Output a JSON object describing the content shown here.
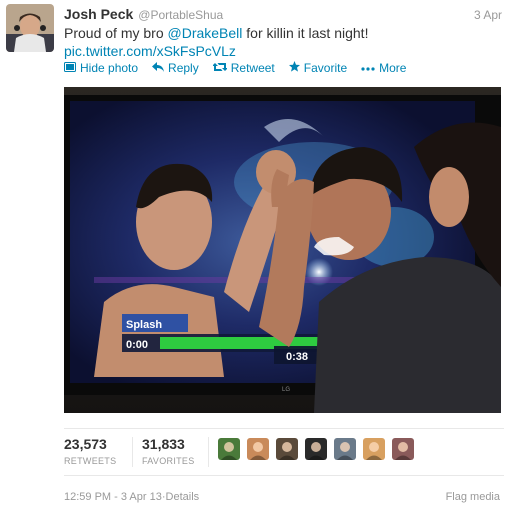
{
  "tweet": {
    "fullname": "Josh Peck",
    "username": "@PortableShua",
    "date": "3 Apr",
    "text_before": "Proud of my bro ",
    "mention": "@DrakeBell",
    "text_after": " for killin it last night!",
    "pic_link": "pic.twitter.com/xSkFsPcVLz"
  },
  "actions": {
    "hide_photo": "Hide photo",
    "reply": "Reply",
    "retweet": "Retweet",
    "favorite": "Favorite",
    "more": "More"
  },
  "media": {
    "show_label": "Splash",
    "time_elapsed": "0:00",
    "time_total": "0:38",
    "tv_brand": "LG",
    "progress_fraction": 0.9
  },
  "stats": {
    "retweets_count": "23,573",
    "retweets_label": "RETWEETS",
    "favorites_count": "31,833",
    "favorites_label": "FAVORITES"
  },
  "favoriters": [
    {
      "name": "favoriter-avatar-1",
      "color": "#4a7a3a"
    },
    {
      "name": "favoriter-avatar-2",
      "color": "#c98a5a"
    },
    {
      "name": "favoriter-avatar-3",
      "color": "#5a4a3a"
    },
    {
      "name": "favoriter-avatar-4",
      "color": "#2a2a2a"
    },
    {
      "name": "favoriter-avatar-5",
      "color": "#6a7a8a"
    },
    {
      "name": "favoriter-avatar-6",
      "color": "#d8a060"
    },
    {
      "name": "favoriter-avatar-7",
      "color": "#8a5a5a"
    }
  ],
  "footer": {
    "timestamp": "12:59 PM - 3 Apr 13",
    "separator": " · ",
    "details": "Details",
    "flag_media": "Flag media"
  },
  "colors": {
    "link": "#0084b4",
    "muted": "#999999",
    "progress": "#2ecc40"
  }
}
